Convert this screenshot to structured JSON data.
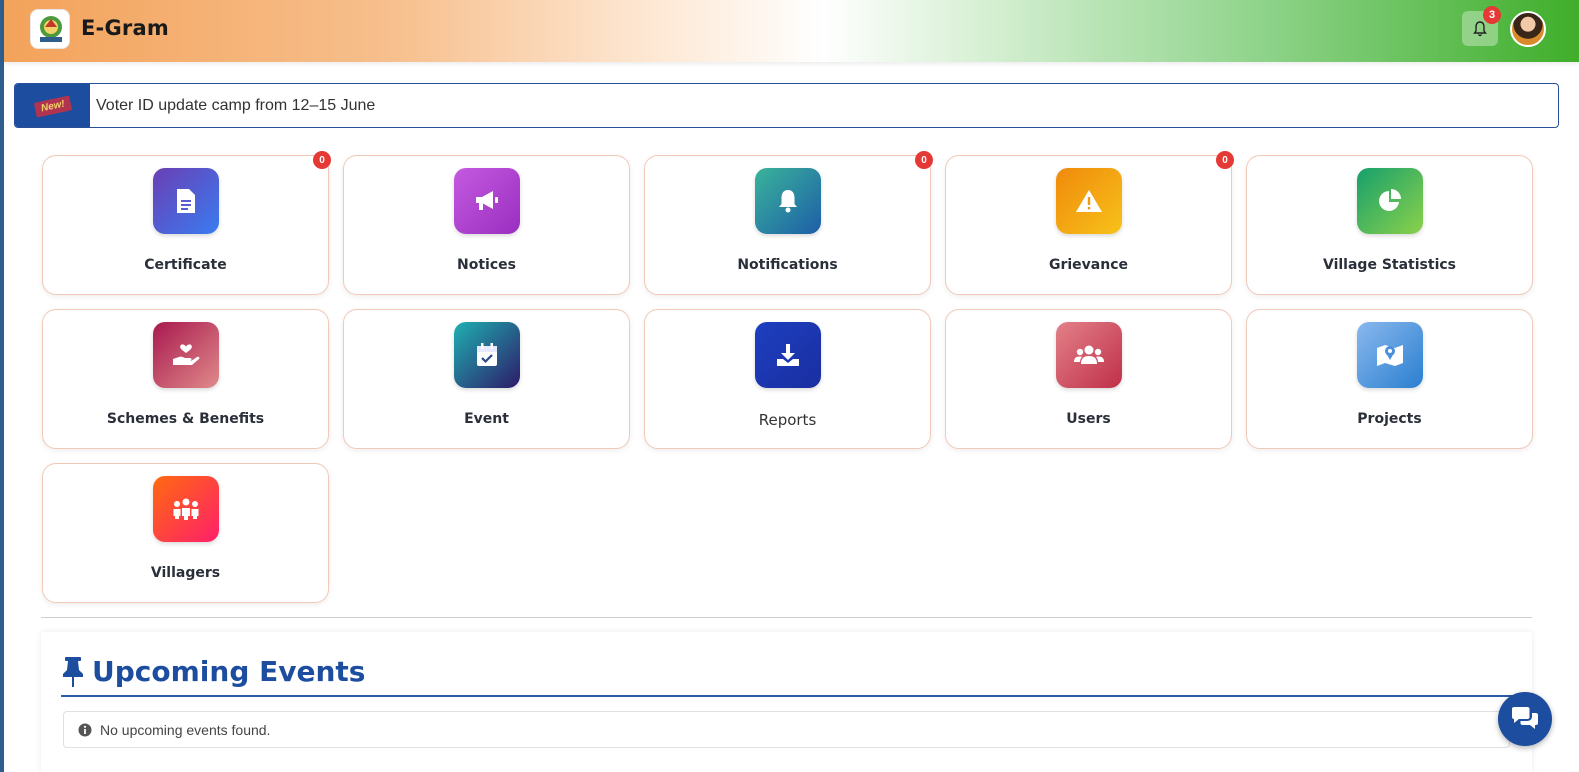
{
  "header": {
    "app_title": "E-Gram",
    "notification_count": "3"
  },
  "ticker": {
    "new_label": "New!",
    "message": "Voter ID update camp from 12–15 June"
  },
  "tiles": [
    {
      "label": "Certificate",
      "badge": "0",
      "icon": "file-icon"
    },
    {
      "label": "Notices",
      "badge": null,
      "icon": "megaphone-icon"
    },
    {
      "label": "Notifications",
      "badge": "0",
      "icon": "bell-icon"
    },
    {
      "label": "Grievance",
      "badge": "0",
      "icon": "warning-icon"
    },
    {
      "label": "Village Statistics",
      "badge": null,
      "icon": "pie-chart-icon"
    },
    {
      "label": "Schemes & Benefits",
      "badge": null,
      "icon": "hand-heart-icon"
    },
    {
      "label": "Event",
      "badge": null,
      "icon": "calendar-check-icon"
    },
    {
      "label": "Reports",
      "badge": null,
      "icon": "download-icon"
    },
    {
      "label": "Users",
      "badge": null,
      "icon": "users-icon"
    },
    {
      "label": "Projects",
      "badge": null,
      "icon": "map-pin-icon"
    },
    {
      "label": "Villagers",
      "badge": null,
      "icon": "people-group-icon"
    }
  ],
  "events": {
    "title": "Upcoming Events",
    "empty_message": "No upcoming events found."
  },
  "colors": {
    "primary": "#1d4d9e",
    "badge": "#e53935"
  }
}
